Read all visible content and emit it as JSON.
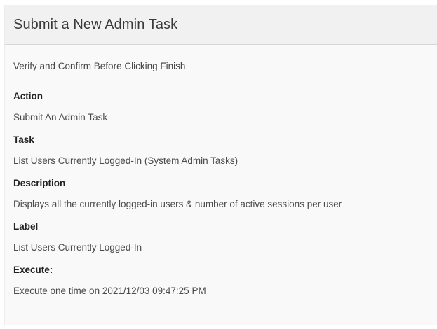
{
  "dialog": {
    "title": "Submit a New Admin Task",
    "subtitle": "Verify and Confirm Before Clicking Finish",
    "fields": [
      {
        "label": "Action",
        "value": "Submit An Admin Task"
      },
      {
        "label": "Task",
        "value": "List Users Currently Logged-In (System Admin Tasks)"
      },
      {
        "label": "Description",
        "value": "Displays all the currently logged-in users & number of active sessions per user"
      },
      {
        "label": "Label",
        "value": "List Users Currently Logged-In"
      },
      {
        "label": "Execute:",
        "value": "Execute one time on 2021/12/03 09:47:25 PM"
      }
    ]
  }
}
